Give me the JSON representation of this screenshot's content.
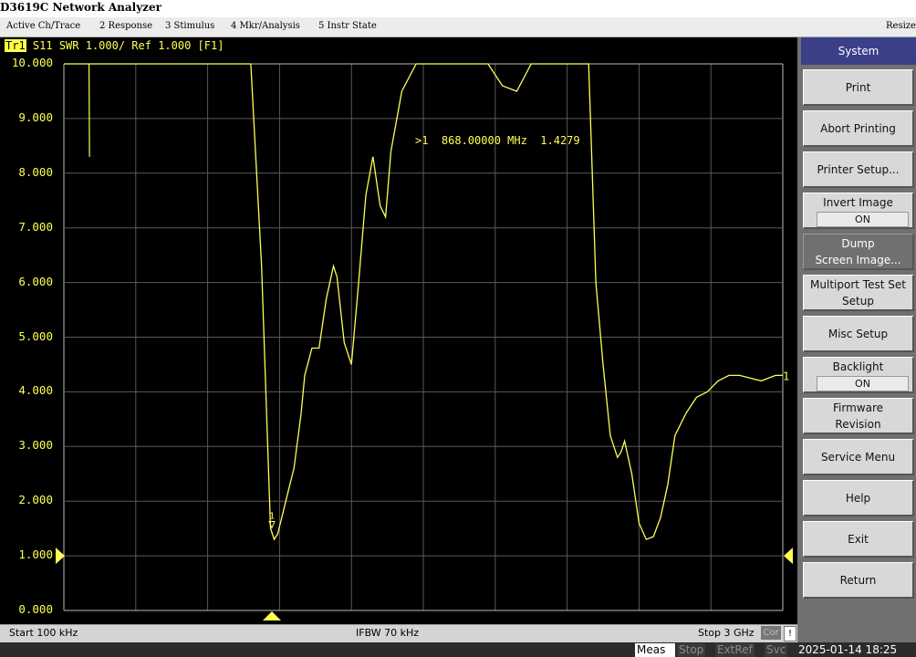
{
  "window": {
    "title": "D3619C Network Analyzer"
  },
  "menu": {
    "items": [
      "Active Ch/Trace",
      "2 Response",
      "3 Stimulus",
      "4 Mkr/Analysis",
      "5 Instr State"
    ],
    "resize": "Resize"
  },
  "trace": {
    "label": "Tr1",
    "info": "S11  SWR 1.000/ Ref 1.000 [F1]",
    "color": "#ffff55"
  },
  "marker": {
    "readout": ">1  868.00000 MHz  1.4279",
    "number": "1",
    "freq_mhz": 868.0,
    "value": 1.4279,
    "end_label": "1"
  },
  "status": {
    "start": "Start 100 kHz",
    "ifbw": "IFBW 70 kHz",
    "stop": "Stop 3 GHz",
    "cor": "Cor",
    "warn": "!"
  },
  "bottom": {
    "meas": "Meas",
    "stop": "Stop",
    "extref": "ExtRef",
    "svc": "Svc",
    "datetime": "2025-01-14 18:25"
  },
  "softkeys": {
    "title": "System",
    "keys": [
      {
        "label": "Print"
      },
      {
        "label": "Abort Printing"
      },
      {
        "label": "Printer Setup..."
      },
      {
        "label": "Invert Image",
        "value": "ON"
      },
      {
        "label": "Dump\nScreen Image..."
      },
      {
        "label": "Multiport Test Set\nSetup"
      },
      {
        "label": "Misc Setup"
      },
      {
        "label": "Backlight",
        "value": "ON"
      },
      {
        "label": "Firmware\nRevision"
      },
      {
        "label": "Service Menu"
      },
      {
        "label": "Help"
      },
      {
        "label": "Exit"
      },
      {
        "label": "Return"
      }
    ]
  },
  "chart_data": {
    "type": "line",
    "xlabel": "",
    "ylabel": "",
    "xlim": [
      0.0001,
      3000
    ],
    "x_unit": "MHz",
    "ylim": [
      0,
      10
    ],
    "yticks": [
      "0.000",
      "1.000",
      "2.000",
      "3.000",
      "4.000",
      "5.000",
      "6.000",
      "7.000",
      "8.000",
      "9.000",
      "10.000"
    ],
    "reference_level": 1.0,
    "grid": true,
    "series": [
      {
        "x": [
          0.0001,
          30,
          37.5,
          40.5,
          45,
          52.5,
          67.5,
          75,
          90,
          120,
          150,
          180,
          232.5,
          255,
          270,
          276,
          300,
          345,
          390,
          435,
          465,
          480,
          495,
          510,
          540,
          570,
          585,
          600,
          615,
          645,
          675,
          705,
          720,
          735,
          742.5,
          750,
          780,
          825,
          862.5,
          877.5,
          892.5,
          915,
          937.5,
          960,
          990,
          1005,
          1035,
          1065,
          1095,
          1125,
          1140,
          1170,
          1200,
          1230,
          1260,
          1290,
          1320,
          1342.5,
          1350,
          1365,
          1410,
          1470,
          1515,
          1530,
          1545,
          1560,
          1575,
          1590,
          1605,
          1620,
          1650,
          1710,
          1770,
          1830,
          1890,
          1950,
          2010,
          2070,
          2100,
          2145,
          2190,
          2205,
          2220,
          2250,
          2280,
          2310,
          2325,
          2340,
          2370,
          2400,
          2430,
          2460,
          2490,
          2520,
          2550,
          2595,
          2640,
          2685,
          2730,
          2775,
          2820,
          2865,
          2910,
          2940,
          2970,
          3000
        ],
        "y": [
          10,
          10,
          10,
          10,
          10,
          10,
          10,
          10,
          10,
          10,
          10,
          10,
          10,
          10,
          10,
          10,
          10,
          10,
          10,
          10,
          10,
          10,
          10,
          10,
          10,
          10,
          10,
          10,
          10,
          10,
          10,
          10,
          10,
          10,
          10,
          10,
          10,
          6.3,
          1.5,
          1.3,
          1.4,
          1.8,
          2.2,
          2.6,
          3.6,
          4.3,
          4.8,
          4.8,
          5.7,
          6.3,
          6.1,
          4.9,
          4.5,
          6.0,
          7.6,
          8.3,
          7.4,
          7.2,
          7.6,
          8.4,
          9.5,
          10,
          10,
          10,
          10,
          10,
          10,
          10,
          10,
          10,
          10,
          10,
          10,
          9.6,
          9.5,
          10,
          10,
          10,
          10,
          10,
          10,
          8.0,
          6.0,
          4.5,
          3.2,
          2.8,
          2.9,
          3.1,
          2.5,
          1.6,
          1.3,
          1.35,
          1.7,
          2.3,
          3.2,
          3.6,
          3.9,
          4.0,
          4.2,
          4.3,
          4.3,
          4.25,
          4.2,
          4.25,
          4.3,
          4.3
        ]
      }
    ]
  }
}
